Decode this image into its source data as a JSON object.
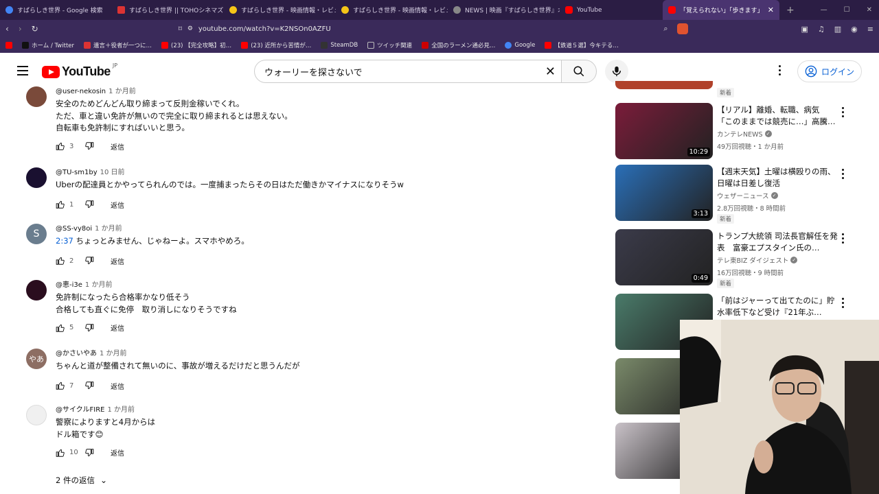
{
  "tabs": [
    {
      "label": "すばらしき世界 - Google 検索",
      "color": "#4285f4"
    },
    {
      "label": "すばらしき世界 || TOHOシネマズ",
      "color": "#d33"
    },
    {
      "label": "すばらしき世界 - 映画情報・レビュー・評価",
      "color": "#f5c518"
    },
    {
      "label": "すばらしき世界 - 映画情報・レビュー・評価",
      "color": "#f5c518"
    },
    {
      "label": "NEWS | 映画『すばらしき世界』オフィシャル",
      "color": "#888"
    },
    {
      "label": "YouTube",
      "color": "#f00"
    },
    {
      "label": "「覚えられない」「歩きます」違反行為",
      "color": "#f00"
    }
  ],
  "address": {
    "url": "youtube.com/watch?v=K2NSOn0AZFU"
  },
  "bookmarks": [
    {
      "label": "ホーム / Twitter",
      "color": "#111"
    },
    {
      "label": "遺言＋役者が一つに…",
      "color": "#d33"
    },
    {
      "label": "(23) 【完全攻略】初…",
      "color": "#f00"
    },
    {
      "label": "(23) 近所から苦情が…",
      "color": "#f00"
    },
    {
      "label": "SteamDB",
      "color": "#333"
    },
    {
      "label": "ツイッチ関連",
      "color": "#999"
    },
    {
      "label": "全国のラーメン通必見…",
      "color": "#c00"
    },
    {
      "label": "Google",
      "color": "#4285f4"
    },
    {
      "label": "【鉄道５選】今キテる…",
      "color": "#f00"
    }
  ],
  "header": {
    "logo_text": "YouTube",
    "logo_country": "JP",
    "search_query": "ウォーリーを探さないで",
    "login_label": "ログイン"
  },
  "comments": [
    {
      "author": "@user-nekosin",
      "time": "1 か月前",
      "lines": [
        "安全のためどんどん取り締まって反則金稼いでくれ。",
        "ただ、車と違い免許が無いので完全に取り締まれるとは思えない。",
        "自転車も免許制にすればいいと思う。"
      ],
      "likes": "3",
      "reply": "返信",
      "avatar_color": "#7a4a3a",
      "avatar_letter": ""
    },
    {
      "author": "@TU-sm1by",
      "time": "10 日前",
      "lines": [
        "Uberの配達員とかやってられんのでは。一度捕まったらその日はただ働きかマイナスになりそうw"
      ],
      "likes": "1",
      "reply": "返信",
      "avatar_color": "#1a1030",
      "avatar_letter": ""
    },
    {
      "author": "@SS-vy8oi",
      "time": "1 か月前",
      "timestamp_link": "2:37",
      "lines": [
        " ちょっとみません、じゃねーよ。スマホやめろ。"
      ],
      "likes": "2",
      "reply": "返信",
      "avatar_color": "#6a7d8e",
      "avatar_letter": "S"
    },
    {
      "author": "@恵-i3e",
      "time": "1 か月前",
      "lines": [
        "免許制になったら合格率かなり低そう",
        "合格しても直ぐに免停　取り消しになりそうですね"
      ],
      "likes": "5",
      "reply": "返信",
      "avatar_color": "#2a0d1e",
      "avatar_letter": ""
    },
    {
      "author": "@かさいやあ",
      "time": "1 か月前",
      "lines": [
        "ちゃんと道が整備されて無いのに、事故が増えるだけだと思うんだが"
      ],
      "likes": "7",
      "reply": "返信",
      "avatar_color": "#8d6e63",
      "avatar_letter": "やあ"
    },
    {
      "author": "@サイクルFIRE",
      "time": "1 か月前",
      "lines": [
        "警察によりますと4月からは",
        "ドル箱です😊"
      ],
      "likes": "10",
      "reply": "返信",
      "avatar_color": "#f0f0f0",
      "avatar_letter": ""
    }
  ],
  "replies_toggle": "2 件の返信",
  "sidebar": {
    "top_badge": "新着",
    "videos": [
      {
        "title": "【リアル】離婚、転職、病気 「このままでは競売に…」高騰…",
        "channel": "カンテレNEWS",
        "verified": true,
        "meta": "49万回視聴・1 か月前",
        "duration": "10:29",
        "badge": "",
        "thumb_color": "#7b1c3a"
      },
      {
        "title": "【週末天気】土曜は横殴りの雨、日曜は日差し復活",
        "channel": "ウェザーニュース",
        "verified": true,
        "meta": "2.8万回視聴・8 時間前",
        "duration": "3:13",
        "badge": "新着",
        "thumb_color": "#2a6fb8"
      },
      {
        "title": "トランプ大統領 司法長官解任を発表　富豪エプスタイン氏の…",
        "channel": "テレ東BIZ ダイジェスト",
        "verified": true,
        "meta": "16万回視聴・9 時間前",
        "duration": "0:49",
        "badge": "新着",
        "thumb_color": "#3b3b4a"
      },
      {
        "title": "「前はジャーって出てたのに」貯水率低下など受け『21年ぶ…",
        "channel": "",
        "verified": false,
        "meta": "",
        "duration": "",
        "badge": "",
        "thumb_color": "#4a7b6a"
      },
      {
        "title": "",
        "channel": "",
        "verified": false,
        "meta": "",
        "duration": "",
        "badge": "",
        "thumb_color": "#7a8a6a"
      },
      {
        "title": "",
        "channel": "",
        "verified": false,
        "meta": "",
        "duration": "",
        "badge": "",
        "thumb_color": "#c9c2c8"
      }
    ]
  },
  "colors": {
    "accent": "#065fd4",
    "yt_red": "#ff0000",
    "chrome": "#3a2a5a"
  }
}
